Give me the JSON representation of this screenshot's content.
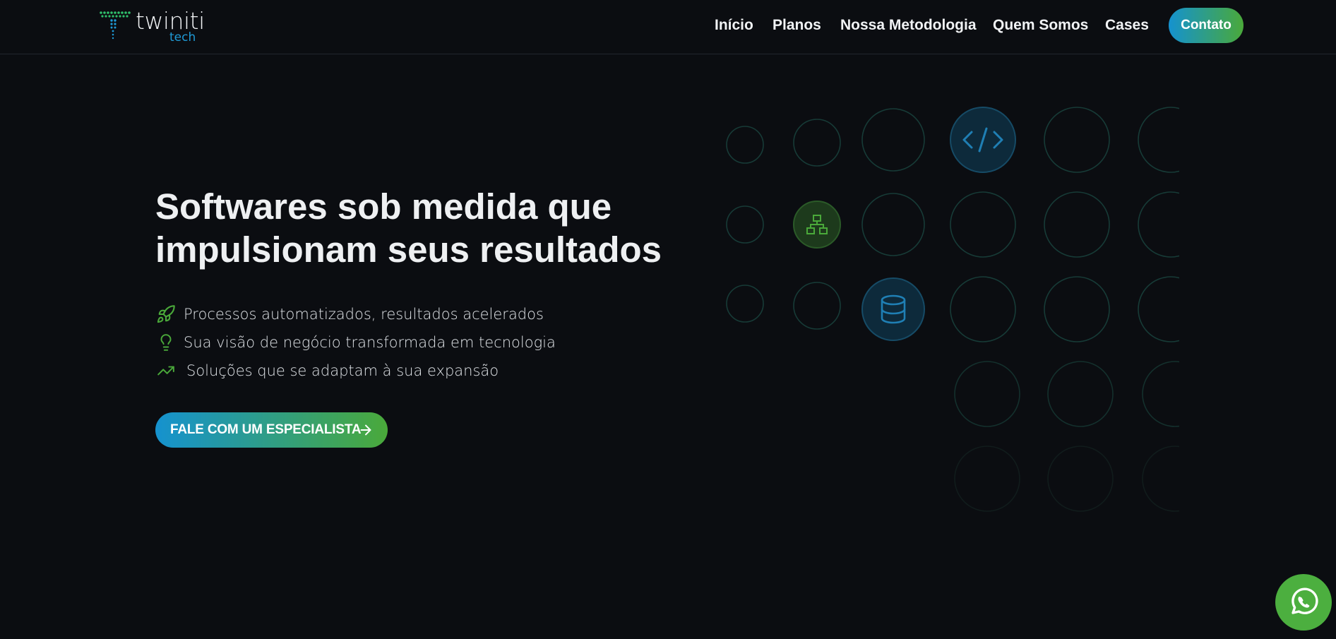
{
  "brand": {
    "name": "twiniti",
    "sub": "tech",
    "colors": {
      "blue": "#1592cf",
      "green": "#4aa93a",
      "background": "#0b0d11"
    }
  },
  "nav": {
    "items": [
      "Início",
      "Planos",
      "Nossa Metodologia",
      "Quem Somos",
      "Cases"
    ],
    "contact": "Contato"
  },
  "hero": {
    "title_line1": "Softwares sob medida que",
    "title_line2": "impulsionam seus resultados",
    "bullets": [
      {
        "icon": "rocket-icon",
        "text": "Processos automatizados, resultados acelerados"
      },
      {
        "icon": "lightbulb-icon",
        "text": "Sua visão de negócio transformada em tecnologia"
      },
      {
        "icon": "trending-up-icon",
        "text": "Soluções que se adaptam à sua expansão"
      }
    ],
    "cta": "FALE COM UM ESPECIALISTA"
  },
  "decor": {
    "highlighted_icons": [
      "code-icon",
      "sitemap-icon",
      "database-icon"
    ]
  },
  "whatsapp": {
    "icon": "whatsapp-icon"
  }
}
